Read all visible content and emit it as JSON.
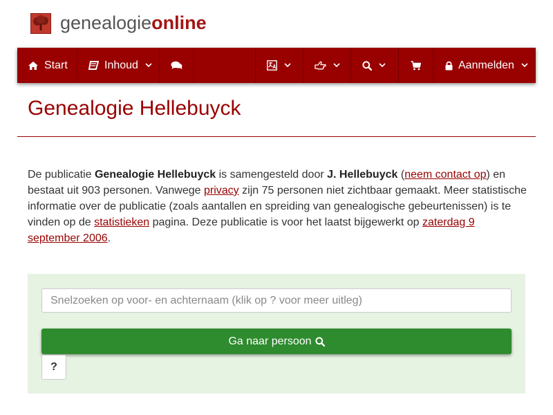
{
  "logo": {
    "part1": "genealogie",
    "part2": "online"
  },
  "nav": {
    "start": {
      "label": "Start",
      "icon": "home-icon"
    },
    "inhoud": {
      "label": "Inhoud",
      "icon": "book-icon"
    },
    "chat": {
      "icon": "comments-icon"
    },
    "language": {
      "icon": "translate-icon"
    },
    "share": {
      "icon": "hand-pointer-icon"
    },
    "search": {
      "icon": "search-icon"
    },
    "cart": {
      "icon": "shopping-cart-icon"
    },
    "login": {
      "label": "Aanmelden",
      "icon": "lock-icon"
    }
  },
  "page": {
    "title": "Genealogie Hellebuyck"
  },
  "intro": {
    "t1": "De publicatie ",
    "pub_name": "Genealogie Hellebuyck",
    "t2": " is samengesteld door ",
    "author": "J. Hellebuyck",
    "t3": " (",
    "contact_link": "neem contact op",
    "t4": ") en bestaat uit 903 personen. Vanwege ",
    "privacy_link": "privacy",
    "t5": " zijn 75 personen niet zichtbaar gemaakt. Meer statistische informatie over de publicatie (zoals aantallen en spreiding van genealogische gebeurtenissen) is te vinden op de ",
    "stats_link": "statistieken",
    "t6": " pagina. Deze publicatie is voor het laatst bijgewerkt op ",
    "date_link": "zaterdag 9 september 2006",
    "t7": "."
  },
  "search": {
    "placeholder": "Snelzoeken op voor- en achternaam (klik op ? voor meer uitleg)",
    "go_label": "Ga naar persoon",
    "help_label": "?"
  },
  "colors": {
    "brand": "#990000",
    "go_button": "#2e8b2e",
    "panel": "#e6f2e2"
  }
}
